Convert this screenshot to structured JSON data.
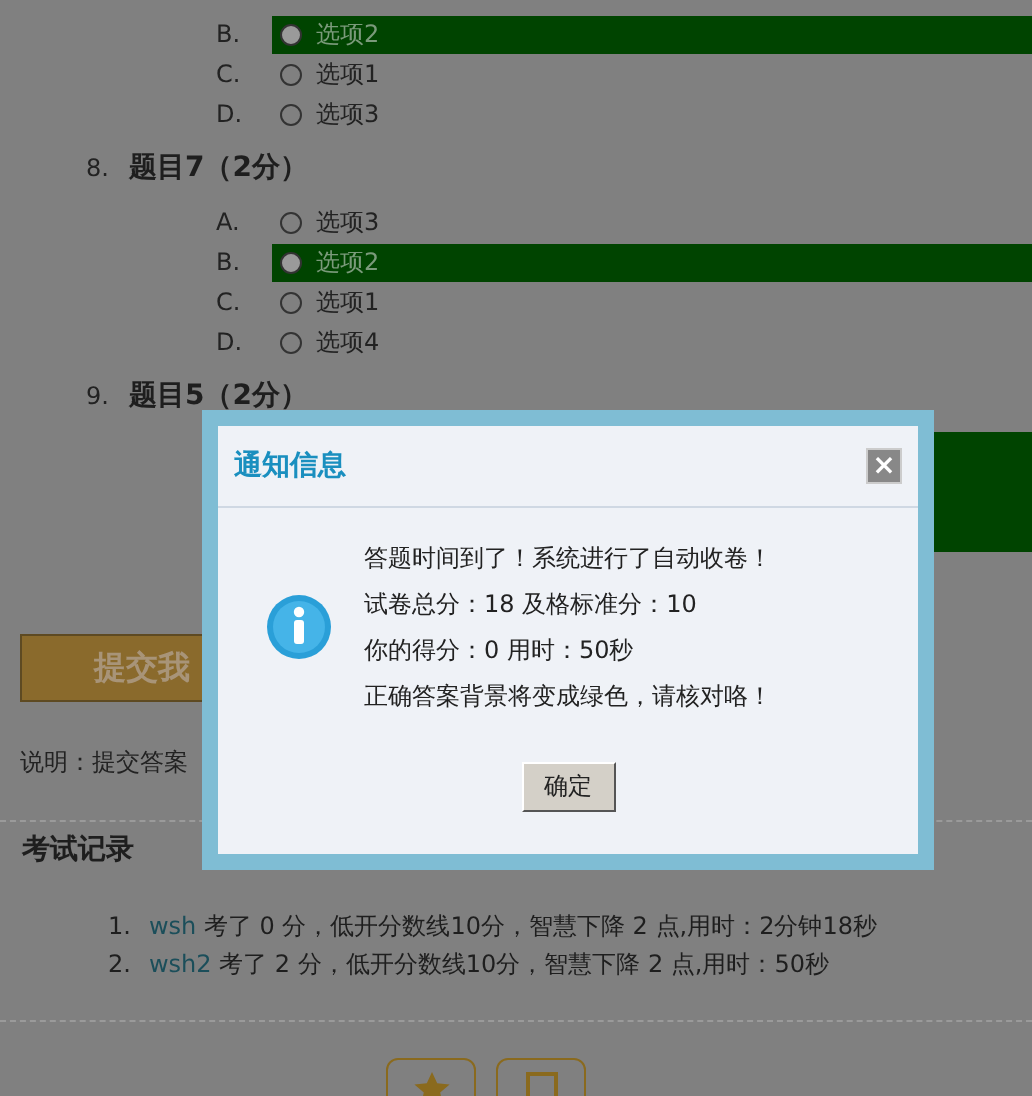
{
  "questions": [
    {
      "options": [
        {
          "letter": "B.",
          "text": "选项2",
          "selected": true,
          "correct": true
        },
        {
          "letter": "C.",
          "text": "选项1",
          "selected": false,
          "correct": false
        },
        {
          "letter": "D.",
          "text": "选项3",
          "selected": false,
          "correct": false
        }
      ]
    },
    {
      "number": "8.",
      "title": "题目7（2分）",
      "options": [
        {
          "letter": "A.",
          "text": "选项3",
          "selected": false,
          "correct": false
        },
        {
          "letter": "B.",
          "text": "选项2",
          "selected": true,
          "correct": true
        },
        {
          "letter": "C.",
          "text": "选项1",
          "selected": false,
          "correct": false
        },
        {
          "letter": "D.",
          "text": "选项4",
          "selected": false,
          "correct": false
        }
      ]
    },
    {
      "number": "9.",
      "title": "题目5（2分）",
      "answer_band": true
    }
  ],
  "submit_button": "提交我",
  "note": "说明：提交答案",
  "records": {
    "title": "考试记录",
    "items": [
      {
        "number": "1.",
        "user": "wsh",
        "text": "考了  0 分，低开分数线10分，智慧下降  2 点,用时：2分钟18秒"
      },
      {
        "number": "2.",
        "user": "wsh2",
        "text": "考了  2 分，低开分数线10分，智慧下降  2 点,用时：50秒"
      }
    ]
  },
  "dialog": {
    "title": "通知信息",
    "close": "×",
    "lines": [
      "答题时间到了！系统进行了自动收卷！",
      "试卷总分：18 及格标准分：10",
      "你的得分：0 用时：50秒",
      "正确答案背景将变成绿色，请核对咯！"
    ],
    "ok": "确定"
  }
}
